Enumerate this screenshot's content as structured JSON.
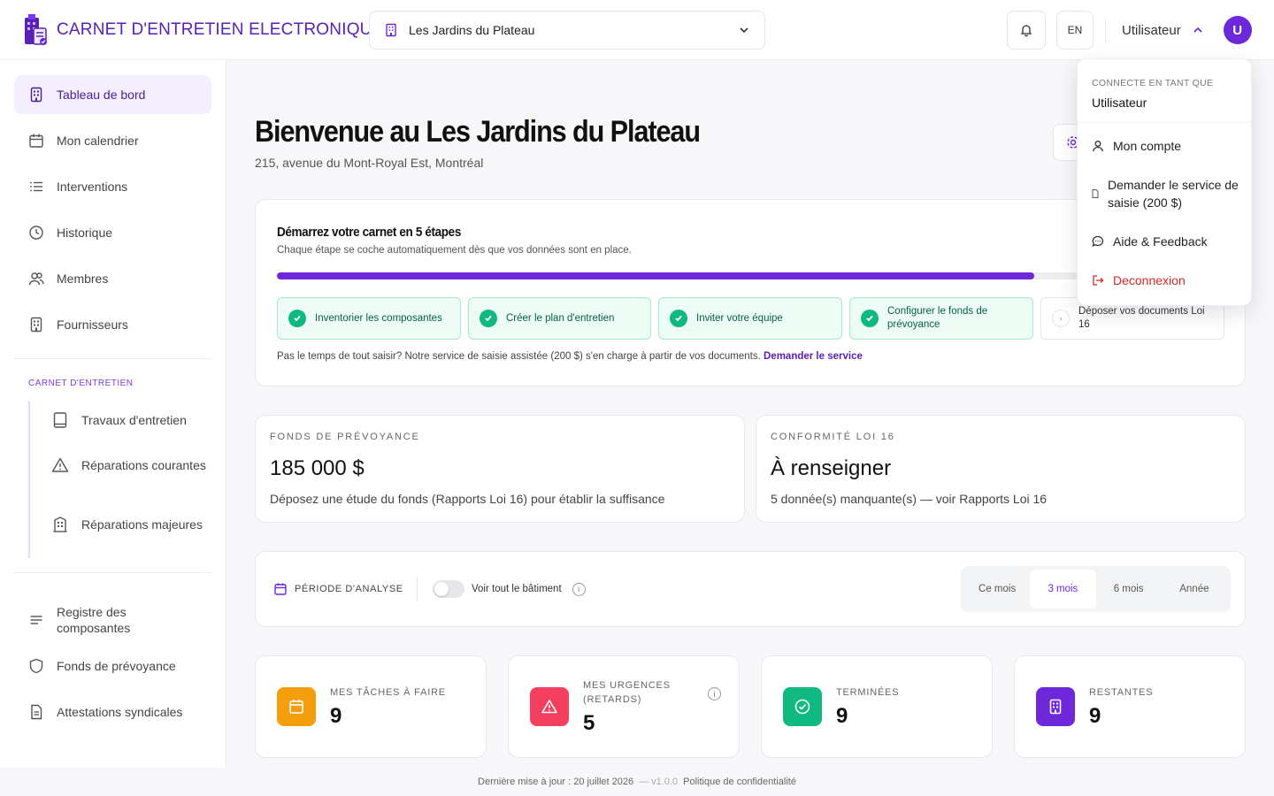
{
  "header": {
    "app_title": "CARNET D'ENTRETIEN ELECTRONIQUE",
    "building_selected": "Les Jardins du Plateau",
    "lang_button": "EN",
    "user_name": "Utilisateur",
    "avatar_initial": "U"
  },
  "sidebar": {
    "main_items": [
      {
        "label": "Tableau de bord",
        "icon": "building-icon",
        "active": true
      },
      {
        "label": "Mon calendrier",
        "icon": "calendar-icon"
      },
      {
        "label": "Interventions",
        "icon": "list-icon"
      },
      {
        "label": "Historique",
        "icon": "clock-icon"
      },
      {
        "label": "Membres",
        "icon": "users-icon"
      },
      {
        "label": "Fournisseurs",
        "icon": "building-icon"
      }
    ],
    "section_label": "CARNET D'ENTRETIEN",
    "sub_items": [
      {
        "label": "Travaux d'entretien",
        "icon": "book-icon"
      },
      {
        "label": "Réparations courantes",
        "icon": "warning-icon"
      },
      {
        "label": "Réparations majeures",
        "icon": "building-icon"
      }
    ],
    "bottom_items": [
      {
        "label": "Registre des composantes",
        "icon": "lines-icon"
      },
      {
        "label": "Fonds de prévoyance",
        "icon": "shield-icon"
      },
      {
        "label": "Attestations syndicales",
        "icon": "document-icon"
      }
    ]
  },
  "welcome": {
    "title": "Bienvenue au Les Jardins du Plateau",
    "address": "215, avenue du Mont-Royal Est, Montréal"
  },
  "onboarding": {
    "title": "Démarrez votre carnet en 5 étapes",
    "subtitle": "Chaque étape se coche automatiquement dès que vos données sont en place.",
    "progress": 0.8,
    "steps": [
      {
        "label": "Inventorier les composantes",
        "done": true
      },
      {
        "label": "Créer le plan d'entretien",
        "done": true
      },
      {
        "label": "Inviter votre équipe",
        "done": true
      },
      {
        "label": "Configurer le fonds de prévoyance",
        "done": true
      },
      {
        "label": "Déposer vos documents Loi 16",
        "done": false
      }
    ],
    "note": "Pas le temps de tout saisir? Notre service de saisie assistée (200 $) s'en charge à partir de vos documents.",
    "note_link": "Demander le service"
  },
  "stats": {
    "fund": {
      "label": "FONDS DE PRÉVOYANCE",
      "value": "185 000 $",
      "description": "Déposez une étude du fonds (Rapports Loi 16) pour établir la suffisance"
    },
    "compliance": {
      "label": "CONFORMITÉ LOI 16",
      "value": "À renseigner",
      "description": "5 donnée(s) manquante(s) — voir Rapports Loi 16"
    }
  },
  "period": {
    "label": "PÉRIODE D'ANALYSE",
    "toggle_label": "Voir tout le bâtiment",
    "info": "i",
    "options": [
      "Ce mois",
      "3 mois",
      "6 mois",
      "Année"
    ],
    "selected": "3 mois"
  },
  "kpis": [
    {
      "label": "MES TÂCHES À FAIRE",
      "value": "9",
      "color": "#f59e0b",
      "icon": "calendar-icon"
    },
    {
      "label": "MES URGENCES (RETARDS)",
      "value": "5",
      "color": "#f43f5e",
      "icon": "warning-icon",
      "info": "i"
    },
    {
      "label": "TERMINÉES",
      "value": "9",
      "color": "#10b981",
      "icon": "check-circle-icon"
    },
    {
      "label": "RESTANTES",
      "value": "9",
      "color": "#6d28d9",
      "icon": "building-icon"
    }
  ],
  "footer": {
    "updated": "Dernière mise à jour : 20 juillet 2026",
    "version": "— v1.0.0",
    "privacy": "Politique de confidentialité"
  },
  "user_dropdown": {
    "header_label": "CONNECTE EN TANT QUE",
    "header_user": "Utilisateur",
    "items": [
      {
        "label": "Mon compte",
        "icon": "user-icon"
      },
      {
        "label": "Demander le service de saisie (200 $)",
        "icon": "document-icon"
      },
      {
        "label": "Aide & Feedback",
        "icon": "chat-icon"
      },
      {
        "label": "Deconnexion",
        "icon": "logout-icon"
      }
    ]
  },
  "colors": {
    "brand": "#5b21b6",
    "accent": "#6d28d9",
    "success": "#10b981",
    "danger": "#dc2626"
  }
}
